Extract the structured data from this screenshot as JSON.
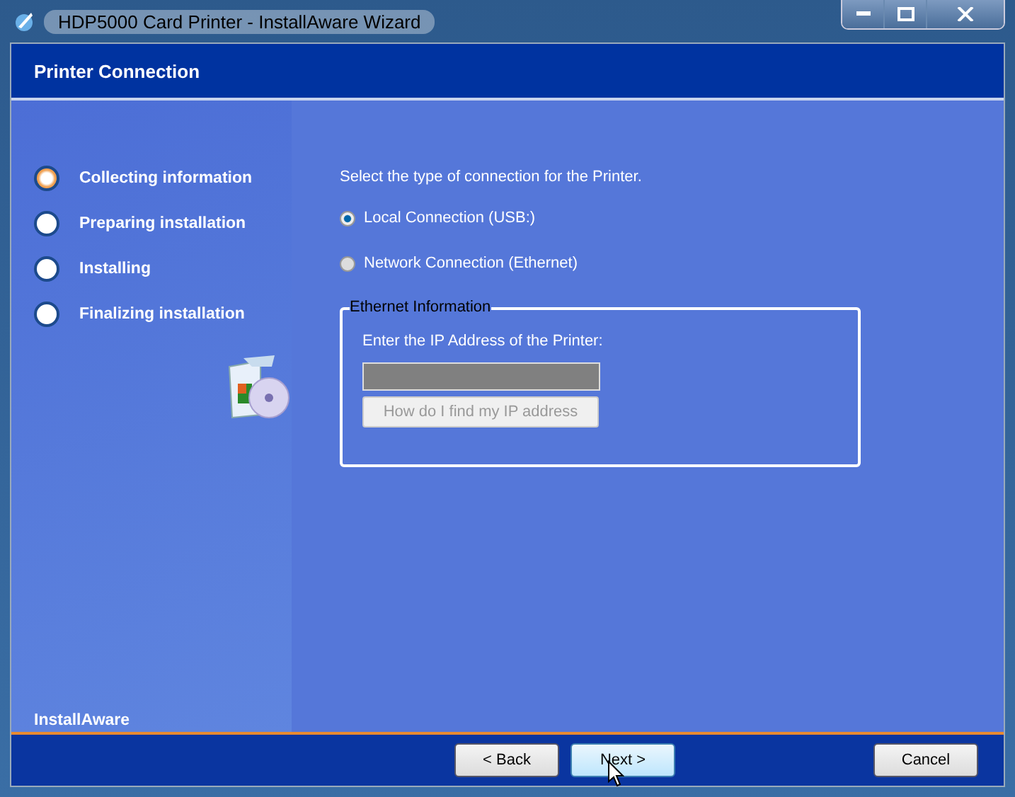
{
  "window": {
    "title": "HDP5000 Card Printer - InstallAware Wizard"
  },
  "header": {
    "title": "Printer Connection"
  },
  "steps": [
    {
      "label": "Collecting information",
      "selected": true
    },
    {
      "label": "Preparing installation",
      "selected": false
    },
    {
      "label": "Installing",
      "selected": false
    },
    {
      "label": "Finalizing installation",
      "selected": false
    }
  ],
  "brand": "InstallAware",
  "prompt": "Select the type of connection for the Printer.",
  "options": [
    {
      "label": "Local Connection (USB:)",
      "selected": true
    },
    {
      "label": "Network Connection (Ethernet)",
      "selected": false
    }
  ],
  "group": {
    "title": "Ethernet Information",
    "label": "Enter the IP Address of the Printer:",
    "field_disabled": true,
    "help_button": {
      "label": "How do I find my IP address",
      "disabled": true
    }
  },
  "buttons": [
    {
      "label": "< Back",
      "focused": false
    },
    {
      "label": "Next >",
      "focused": true
    },
    {
      "label": "Cancel",
      "focused": false
    }
  ]
}
